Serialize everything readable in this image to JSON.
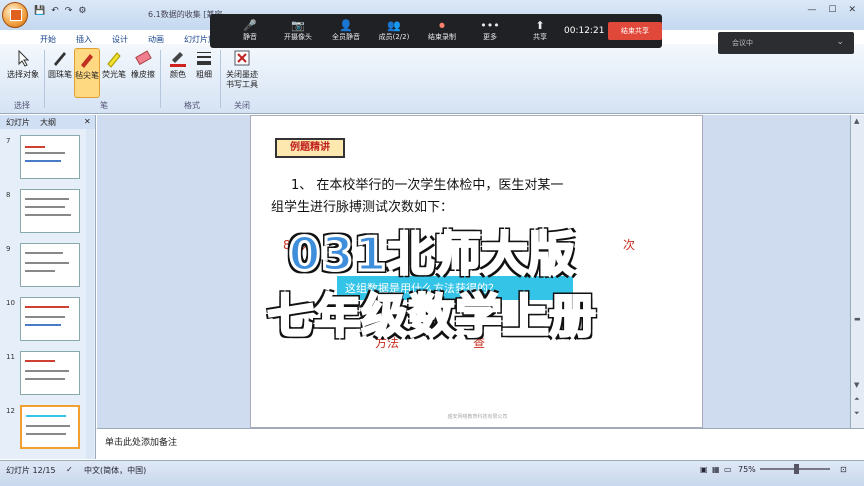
{
  "window": {
    "doc_title": "6.1数据的收集 [兼容",
    "controls": [
      "—",
      "☐",
      "✕"
    ]
  },
  "qat": {
    "items": [
      "💾",
      "↶",
      "↷",
      "⚙"
    ]
  },
  "tabs": [
    "开始",
    "插入",
    "设计",
    "动画",
    "幻灯片放映"
  ],
  "ribbon": {
    "buttons": [
      {
        "label": "选择对象",
        "icon": "select-arrow-icon"
      },
      {
        "label": "圆珠笔",
        "icon": "ballpoint-pen-icon"
      },
      {
        "label": "毡尖笔",
        "icon": "felt-pen-icon",
        "selected": true
      },
      {
        "label": "荧光笔",
        "icon": "highlighter-icon"
      },
      {
        "label": "橡皮擦",
        "icon": "eraser-icon"
      },
      {
        "label": "颜色",
        "icon": "color-icon"
      },
      {
        "label": "粗细",
        "icon": "thickness-icon"
      },
      {
        "label": "关闭墨迹书写工具",
        "icon": "close-ink-icon"
      }
    ],
    "groups": [
      "选择",
      "笔",
      "格式",
      "关闭"
    ]
  },
  "meeting": {
    "buttons": [
      {
        "label": "静音",
        "icon": "mic-icon",
        "glyph": "🎤"
      },
      {
        "label": "开摄像头",
        "icon": "camera-icon",
        "glyph": "📷"
      },
      {
        "label": "全员静音",
        "icon": "mute-all-icon",
        "glyph": "👤"
      },
      {
        "label": "成员(2/2)",
        "icon": "members-icon",
        "glyph": "👥"
      },
      {
        "label": "结束录制",
        "icon": "record-icon",
        "glyph": "⏺"
      },
      {
        "label": "更多",
        "icon": "more-icon",
        "glyph": "•••"
      },
      {
        "label": "共享",
        "icon": "share-icon",
        "glyph": "⬆"
      }
    ],
    "timer": "00:12:21",
    "end_share": "结束共享",
    "status": "会议中"
  },
  "left_pane": {
    "tabs": [
      "幻灯片",
      "大纲"
    ],
    "thumbs": [
      {
        "num": "7"
      },
      {
        "num": "8"
      },
      {
        "num": "9"
      },
      {
        "num": "10"
      },
      {
        "num": "11"
      },
      {
        "num": "12",
        "selected": true
      }
    ]
  },
  "slide": {
    "banner": "例题精讲",
    "q1": "1、 在本校举行的一次学生体检中，医生对某一",
    "q2": "组学生进行脉搏测试次数如下：",
    "red_left": "87次",
    "red_right": "次",
    "cyan_text": "这组数据是用什么方法获得的？",
    "foot_left": "方法",
    "foot_right": "查",
    "footer": "盛安网络教育科技有限公司"
  },
  "overlay": {
    "line1": "031北师大版",
    "line2": "七年级数学上册"
  },
  "notes": {
    "placeholder": "单击此处添加备注"
  },
  "status": {
    "slide_info": "幻灯片 12/15",
    "lang": "中文(简体，中国)",
    "zoom": "75%"
  }
}
